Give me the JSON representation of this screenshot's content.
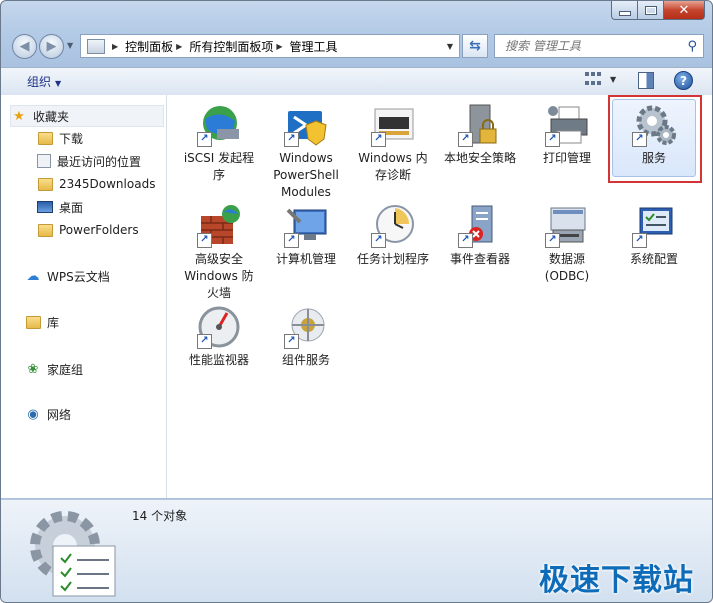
{
  "address": {
    "crumbs": [
      "控制面板",
      "所有控制面板项",
      "管理工具"
    ]
  },
  "search": {
    "placeholder": "搜索 管理工具"
  },
  "toolbar": {
    "organize": "组织"
  },
  "sidebar": {
    "favorites": "收藏夹",
    "fav_items": [
      "下载",
      "最近访问的位置",
      "2345Downloads",
      "桌面",
      "PowerFolders"
    ],
    "groups": [
      "WPS云文档",
      "库",
      "家庭组",
      "网络"
    ]
  },
  "items": [
    "iSCSI 发起程序",
    "Windows PowerShell Modules",
    "Windows 内存诊断",
    "本地安全策略",
    "打印管理",
    "服务",
    "高级安全 Windows 防火墙",
    "计算机管理",
    "任务计划程序",
    "事件查看器",
    "数据源(ODBC)",
    "系统配置",
    "性能监视器",
    "组件服务"
  ],
  "status": {
    "count": "14 个对象"
  },
  "watermark": "极速下载站",
  "colors": {
    "selection_highlight": "#d33434",
    "title_bar": "#b4cbe6"
  }
}
